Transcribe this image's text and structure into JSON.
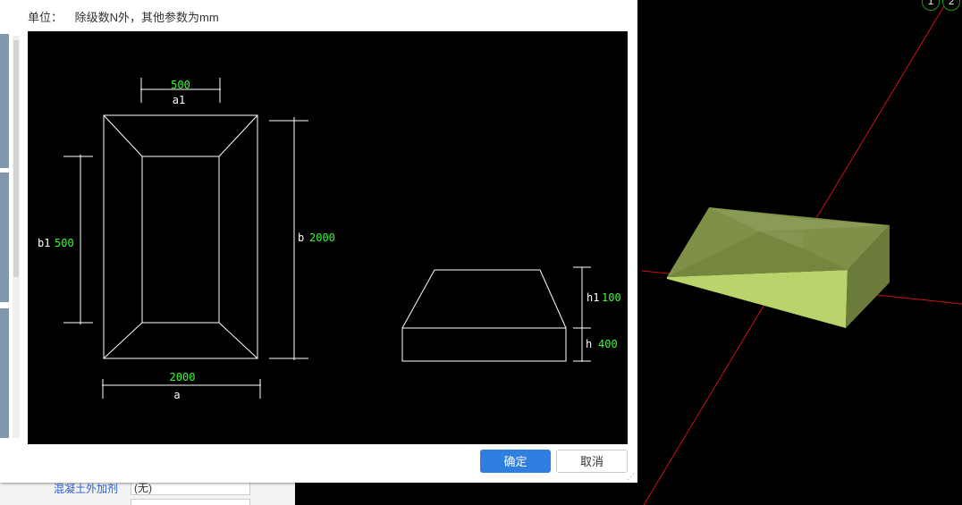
{
  "dialog": {
    "unit_label": "单位：",
    "unit_text": "除级数N外，其他参数为mm",
    "ok_label": "确定",
    "cancel_label": "取消"
  },
  "drawing": {
    "plan": {
      "a1_value": "500",
      "a1_label": "a1",
      "b1_label": "b1",
      "b1_value": "500",
      "b_label": "b",
      "b_value": "2000",
      "a_value": "2000",
      "a_label": "a"
    },
    "section": {
      "h1_label": "h1",
      "h1_value": "100",
      "h_label": "h",
      "h_value": "400"
    },
    "colors": {
      "line": "#ffffff",
      "value": "#33ff33"
    }
  },
  "background_panel": {
    "rows": [
      {
        "key": "混凝土外加剂",
        "value": "(无)"
      }
    ]
  },
  "viewport": {
    "badges": [
      "1",
      "2"
    ],
    "model_colors": {
      "top": "#7a8c45",
      "front": "#b9d46a",
      "side": "#6b7c3a"
    },
    "axis_color": "#d01010"
  }
}
